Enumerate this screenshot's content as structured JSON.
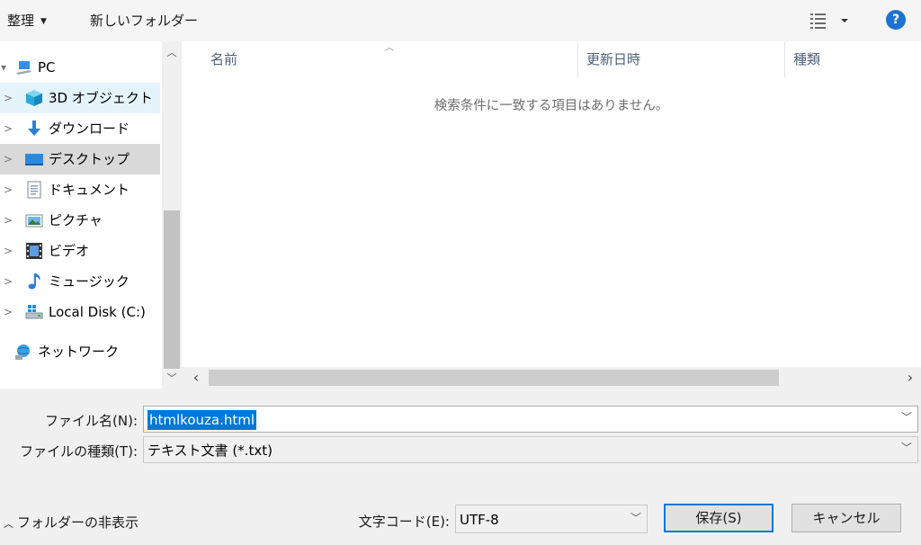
{
  "toolbar": {
    "organize_label": "整理",
    "new_folder_label": "新しいフォルダー",
    "view_icon": "details-view-icon",
    "help_label": "?"
  },
  "nav": {
    "items": [
      {
        "label": "PC",
        "icon": "pc-icon",
        "chevron": "▾",
        "state": "normal"
      },
      {
        "label": "3D オブジェクト",
        "icon": "3d-objects-icon",
        "chevron": "›",
        "state": "hover"
      },
      {
        "label": "ダウンロード",
        "icon": "download-icon",
        "chevron": "›",
        "state": "normal"
      },
      {
        "label": "デスクトップ",
        "icon": "desktop-icon",
        "chevron": "›",
        "state": "selected"
      },
      {
        "label": "ドキュメント",
        "icon": "documents-icon",
        "chevron": "›",
        "state": "normal"
      },
      {
        "label": "ピクチャ",
        "icon": "pictures-icon",
        "chevron": "›",
        "state": "normal"
      },
      {
        "label": "ビデオ",
        "icon": "video-icon",
        "chevron": "›",
        "state": "normal"
      },
      {
        "label": "ミュージック",
        "icon": "music-icon",
        "chevron": "›",
        "state": "normal"
      },
      {
        "label": "Local Disk (C:)",
        "icon": "local-disk-icon",
        "chevron": "›",
        "state": "normal"
      },
      {
        "label": "ネットワーク",
        "icon": "network-icon",
        "chevron": "",
        "state": "normal"
      }
    ]
  },
  "list": {
    "columns": [
      {
        "label": "名前"
      },
      {
        "label": "更新日時"
      },
      {
        "label": "種類"
      }
    ],
    "empty_message": "検索条件に一致する項目はありません。"
  },
  "form": {
    "filename_label": "ファイル名(N):",
    "filename_value": "htmlkouza.html",
    "filetype_label": "ファイルの種類(T):",
    "filetype_value": "テキスト文書 (*.txt)",
    "encoding_label": "文字コード(E):",
    "encoding_value": "UTF-8"
  },
  "footer": {
    "hide_folders_label": "フォルダーの非表示",
    "save_label": "保存(S)",
    "cancel_label": "キャンセル"
  },
  "colors": {
    "accent": "#0078d7",
    "selection": "#d9d9d9",
    "hover": "#e5f3fb",
    "help": "#1e73d0"
  }
}
